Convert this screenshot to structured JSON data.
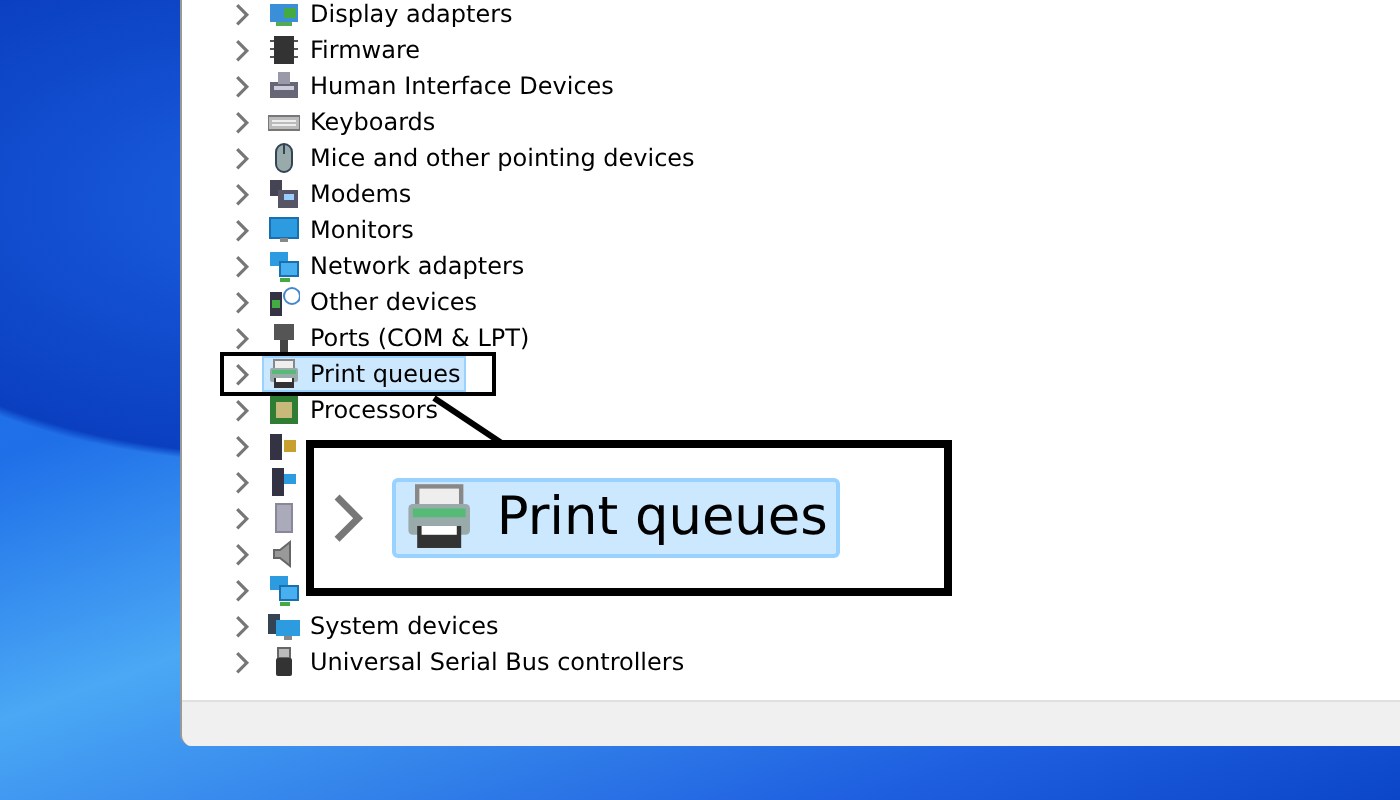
{
  "devices": [
    {
      "kind": "display",
      "label": "Display adapters",
      "selected": false
    },
    {
      "kind": "chip",
      "label": "Firmware",
      "selected": false
    },
    {
      "kind": "hid",
      "label": "Human Interface Devices",
      "selected": false
    },
    {
      "kind": "keyboard",
      "label": "Keyboards",
      "selected": false
    },
    {
      "kind": "mouse",
      "label": "Mice and other pointing devices",
      "selected": false
    },
    {
      "kind": "modem",
      "label": "Modems",
      "selected": false
    },
    {
      "kind": "monitor",
      "label": "Monitors",
      "selected": false
    },
    {
      "kind": "network",
      "label": "Network adapters",
      "selected": false
    },
    {
      "kind": "unknown",
      "label": "Other devices",
      "selected": false
    },
    {
      "kind": "port",
      "label": "Ports (COM & LPT)",
      "selected": false
    },
    {
      "kind": "printer",
      "label": "Print queues",
      "selected": true
    },
    {
      "kind": "processor",
      "label": "Processors",
      "selected": false
    },
    {
      "kind": "security",
      "selected": false
    },
    {
      "kind": "tower",
      "selected": false
    },
    {
      "kind": "storage",
      "selected": false
    },
    {
      "kind": "speaker",
      "selected": false
    },
    {
      "kind": "network",
      "selected": false
    },
    {
      "kind": "system",
      "label": "System devices",
      "selected": false
    },
    {
      "kind": "usb",
      "label": "Universal Serial Bus controllers",
      "selected": false
    }
  ],
  "callout": {
    "kind": "printer",
    "label": "Print queues",
    "selected": true
  }
}
